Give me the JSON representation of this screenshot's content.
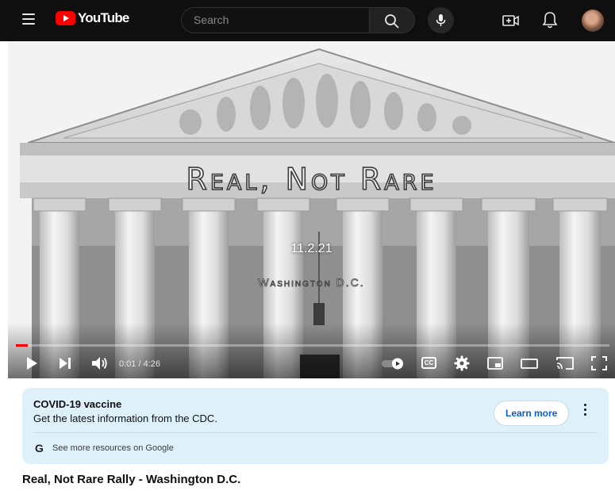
{
  "header": {
    "logo_text": "YouTube",
    "search_placeholder": "Search",
    "icons": [
      "menu-icon",
      "search-icon",
      "mic-icon",
      "create-video-icon",
      "bell-icon",
      "avatar"
    ]
  },
  "video": {
    "overlay_title": "Real, Not Rare",
    "overlay_date": "11.2.21",
    "overlay_place": "Washington D.C.",
    "time": "0:01 / 4:26",
    "progress": 0.004,
    "controls": [
      "play-icon",
      "next-icon",
      "volume-icon",
      "autoplay-toggle",
      "captions-icon",
      "settings-icon",
      "miniplayer-icon",
      "theater-icon",
      "cast-icon",
      "fullscreen-icon"
    ],
    "captions_label": "CC"
  },
  "info_panel": {
    "title": "COVID-19 vaccine",
    "subtitle": "Get the latest information from the CDC.",
    "button": "Learn more",
    "google_letter": "G",
    "link": "See more resources on Google"
  },
  "page": {
    "video_title": "Real, Not Rare Rally - Washington D.C."
  },
  "colors": {
    "topbar": "#0f0f0f",
    "brand_red": "#ff0000",
    "info_panel_bg": "#def1fb",
    "link_blue": "#065fd4"
  }
}
